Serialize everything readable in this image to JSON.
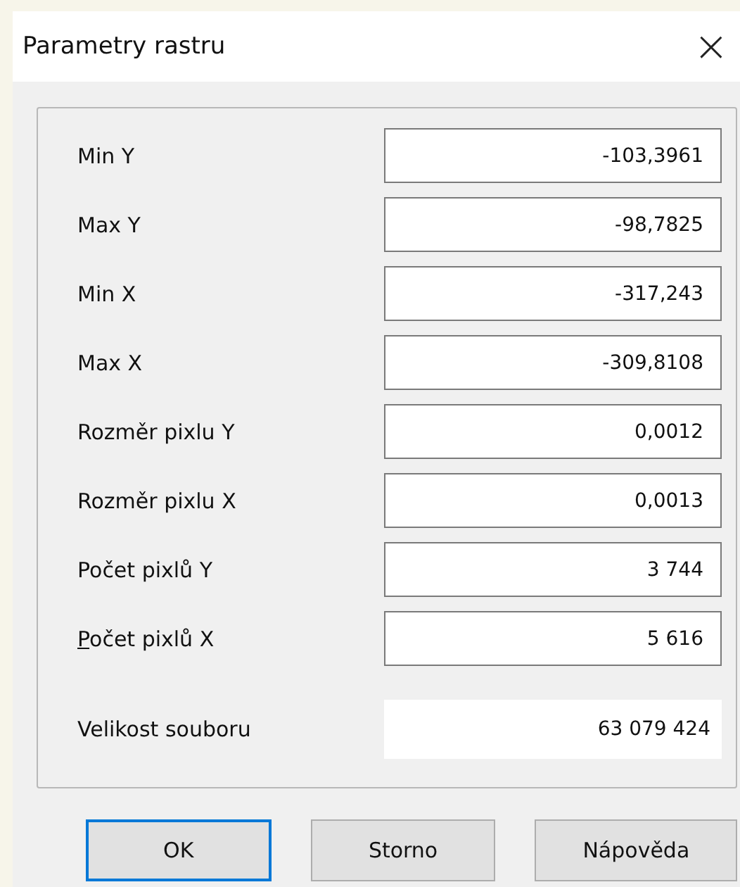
{
  "window": {
    "title": "Parametry rastru",
    "close": "×"
  },
  "fields": [
    {
      "label": "Min Y",
      "value": "-103,3961",
      "kind": "input"
    },
    {
      "label": "Max Y",
      "value": "-98,7825",
      "kind": "input"
    },
    {
      "label": "Min X",
      "value": "-317,243",
      "kind": "input"
    },
    {
      "label": "Max X",
      "value": "-309,8108",
      "kind": "input"
    },
    {
      "label": "Rozměr pixlu Y",
      "value": "0,0012",
      "kind": "input"
    },
    {
      "label": "Rozměr pixlu X",
      "value": "0,0013",
      "kind": "input"
    },
    {
      "label": "Počet pixlů Y",
      "value": "3 744",
      "kind": "input"
    },
    {
      "label": "Počet pixlů X",
      "value": "5 616",
      "kind": "input",
      "mnemonic_first": true
    },
    {
      "label": "Velikost souboru",
      "value": "63 079 424",
      "kind": "readonly"
    }
  ],
  "buttons": [
    {
      "label": "OK",
      "default": true
    },
    {
      "label": "Storno",
      "default": false
    },
    {
      "label": "Nápověda",
      "default": false
    }
  ]
}
